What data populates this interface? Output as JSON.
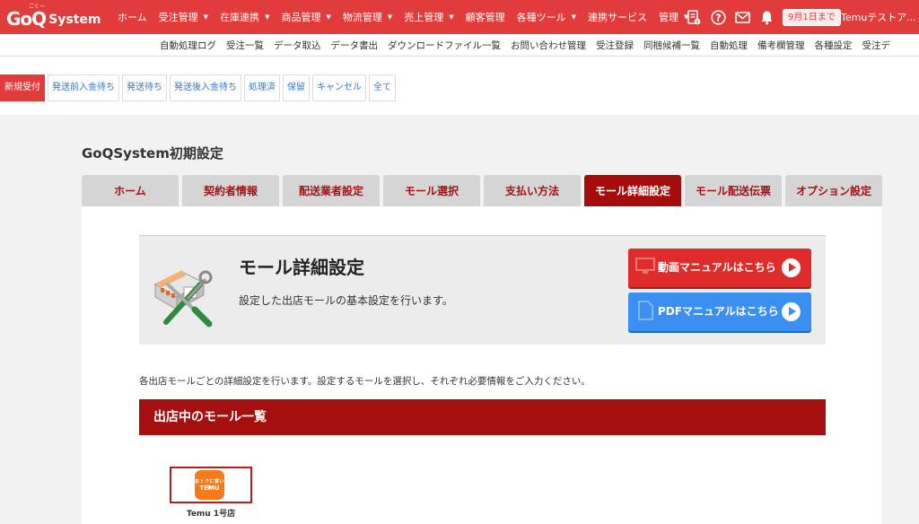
{
  "brand": {
    "logo_main": "GoQ",
    "logo_sub": "System",
    "logo_kana": "ごくー"
  },
  "topnav": [
    {
      "label": "ホーム",
      "dropdown": false
    },
    {
      "label": "受注管理",
      "dropdown": true
    },
    {
      "label": "在庫連携",
      "dropdown": true
    },
    {
      "label": "商品管理",
      "dropdown": true
    },
    {
      "label": "物流管理",
      "dropdown": true
    },
    {
      "label": "売上管理",
      "dropdown": true
    },
    {
      "label": "顧客管理",
      "dropdown": false
    },
    {
      "label": "各種ツール",
      "dropdown": true
    },
    {
      "label": "連携サービス",
      "dropdown": false
    },
    {
      "label": "管理",
      "dropdown": true
    }
  ],
  "top_icons": [
    "document-icon",
    "help-icon",
    "mail-icon",
    "bell-icon"
  ],
  "date_badge": "9月1日まで",
  "user_name": "Temuテストア...",
  "subnav": [
    "自動処理ログ",
    "受注一覧",
    "データ取込",
    "データ書出",
    "ダウンロードファイル一覧",
    "お問い合わせ管理",
    "受注登録",
    "同梱候補一覧",
    "自動処理",
    "備考欄管理",
    "各種設定",
    "受注デ"
  ],
  "status_tabs": [
    "新規受付",
    "発送前入金待ち",
    "発送待ち",
    "発送後入金待ち",
    "処理済",
    "保留",
    "キャンセル",
    "全て"
  ],
  "active_status_tab": 0,
  "page_title": "GoQSystem初期設定",
  "setting_tabs": [
    "ホーム",
    "契約者情報",
    "配送業者設定",
    "モール選択",
    "支払い方法",
    "モール詳細設定",
    "モール配送伝票",
    "オプション設定"
  ],
  "active_setting_tab": 5,
  "hero": {
    "title": "モール詳細設定",
    "description": "設定した出店モールの基本設定を行います。",
    "video_button": "動画マニュアルはこちら",
    "pdf_button": "PDFマニュアルはこちら"
  },
  "info_text": "各出店モールごとの詳細設定を行います。設定するモールを選択し、それぞれ必要情報をご入力ください。",
  "mall_list_header": "出店中のモール一覧",
  "malls": [
    {
      "name": "Temu 1号店",
      "logo_top": "おトクに買い物",
      "logo_text": "TEMU"
    }
  ],
  "colors": {
    "primary_red": "#e23b3b",
    "dark_red": "#a60f0f",
    "blue": "#3a8ff0",
    "temu_orange": "#f47a1c"
  }
}
